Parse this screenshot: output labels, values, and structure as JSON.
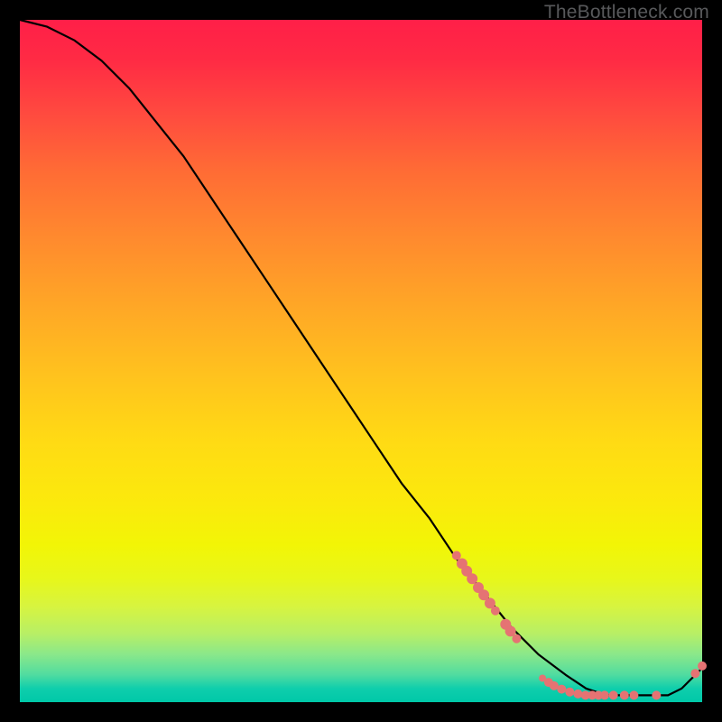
{
  "watermark": "TheBottleneck.com",
  "chart_data": {
    "type": "line",
    "title": "",
    "xlabel": "",
    "ylabel": "",
    "xlim": [
      0,
      100
    ],
    "ylim": [
      0,
      100
    ],
    "grid": false,
    "series": [
      {
        "name": "curve",
        "x": [
          0,
          4,
          8,
          12,
          16,
          20,
          24,
          28,
          32,
          36,
          40,
          44,
          48,
          52,
          56,
          60,
          64,
          68,
          72,
          76,
          80,
          83,
          86,
          89,
          92,
          95,
          97,
          99,
          100
        ],
        "y": [
          100,
          99,
          97,
          94,
          90,
          85,
          80,
          74,
          68,
          62,
          56,
          50,
          44,
          38,
          32,
          27,
          21,
          16,
          11,
          7,
          4,
          2,
          1,
          1,
          1,
          1,
          2,
          4,
          5
        ]
      }
    ],
    "scatter_points": {
      "name": "highlight-points",
      "color": "#e57373",
      "points": [
        {
          "x": 64.0,
          "y": 21.5,
          "r": 5
        },
        {
          "x": 64.8,
          "y": 20.3,
          "r": 6
        },
        {
          "x": 65.5,
          "y": 19.2,
          "r": 6
        },
        {
          "x": 66.3,
          "y": 18.1,
          "r": 6
        },
        {
          "x": 67.2,
          "y": 16.8,
          "r": 6
        },
        {
          "x": 68.0,
          "y": 15.7,
          "r": 6
        },
        {
          "x": 68.9,
          "y": 14.5,
          "r": 6
        },
        {
          "x": 69.7,
          "y": 13.4,
          "r": 5
        },
        {
          "x": 71.2,
          "y": 11.4,
          "r": 6
        },
        {
          "x": 71.9,
          "y": 10.4,
          "r": 6
        },
        {
          "x": 72.8,
          "y": 9.3,
          "r": 5
        },
        {
          "x": 76.6,
          "y": 3.5,
          "r": 4
        },
        {
          "x": 77.5,
          "y": 2.9,
          "r": 5
        },
        {
          "x": 78.3,
          "y": 2.4,
          "r": 5
        },
        {
          "x": 79.4,
          "y": 1.9,
          "r": 5
        },
        {
          "x": 80.6,
          "y": 1.5,
          "r": 5
        },
        {
          "x": 81.8,
          "y": 1.2,
          "r": 5
        },
        {
          "x": 82.9,
          "y": 1.0,
          "r": 5
        },
        {
          "x": 83.9,
          "y": 1.0,
          "r": 5
        },
        {
          "x": 84.8,
          "y": 1.0,
          "r": 5
        },
        {
          "x": 85.7,
          "y": 1.0,
          "r": 5
        },
        {
          "x": 87.0,
          "y": 1.0,
          "r": 5
        },
        {
          "x": 88.6,
          "y": 1.0,
          "r": 5
        },
        {
          "x": 90.0,
          "y": 1.0,
          "r": 5
        },
        {
          "x": 93.3,
          "y": 1.0,
          "r": 5
        },
        {
          "x": 99.0,
          "y": 4.2,
          "r": 5
        },
        {
          "x": 100.0,
          "y": 5.3,
          "r": 5
        }
      ]
    }
  }
}
